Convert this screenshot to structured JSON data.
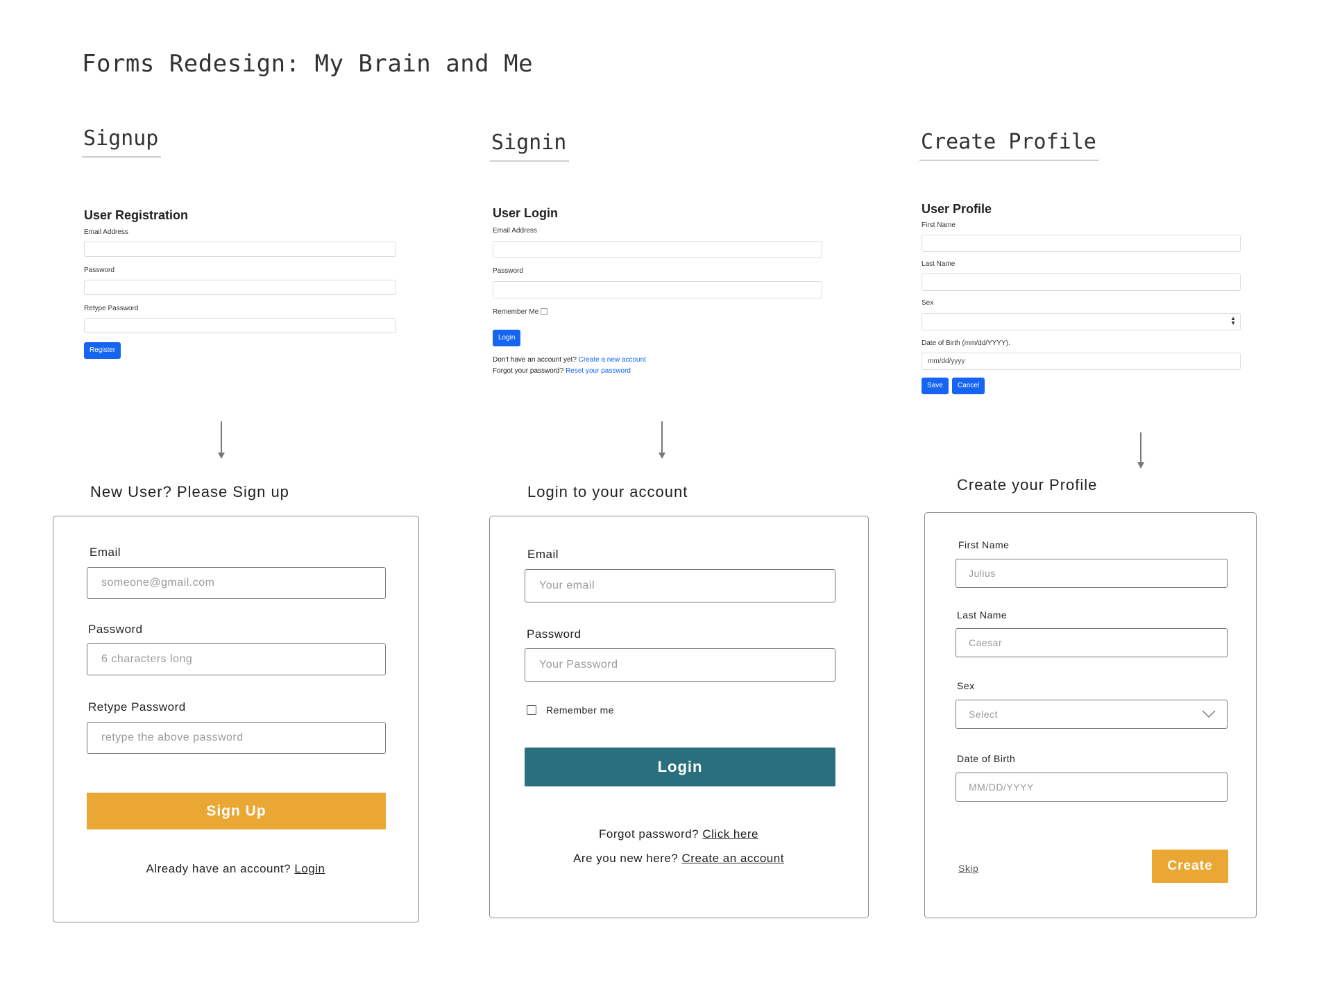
{
  "page_title": "Forms Redesign: My Brain and Me",
  "columns": {
    "signup": "Signup",
    "signin": "Signin",
    "profile": "Create Profile"
  },
  "old_signup": {
    "title": "User Registration",
    "email_label": "Email Address",
    "password_label": "Password",
    "retype_label": "Retype Password",
    "register_button": "Register"
  },
  "old_login": {
    "title": "User Login",
    "email_label": "Email Address",
    "password_label": "Password",
    "remember_label": "Remember Me",
    "login_button": "Login",
    "no_account_text": "Don't have an account yet?",
    "create_link": "Create a new account",
    "forgot_text": "Forgot your password?",
    "reset_link": "Reset your password"
  },
  "old_profile": {
    "title": "User Profile",
    "first_name_label": "First Name",
    "last_name_label": "Last Name",
    "sex_label": "Sex",
    "dob_label": "Date of Birth (mm/dd/YYYY).",
    "dob_placeholder": "mm/dd/yyyy",
    "save_button": "Save",
    "cancel_button": "Cancel"
  },
  "new_signup": {
    "heading": "New User? Please Sign up",
    "email_label": "Email",
    "email_placeholder": "someone@gmail.com",
    "password_label": "Password",
    "password_placeholder": "6 characters long",
    "retype_label": "Retype Password",
    "retype_placeholder": "retype the above password",
    "signup_button": "Sign Up",
    "have_account_text": "Already have an account?",
    "login_link": "Login"
  },
  "new_login": {
    "heading": "Login to your account",
    "email_label": "Email",
    "email_placeholder": "Your email",
    "password_label": "Password",
    "password_placeholder": "Your Password",
    "remember_label": "Remember me",
    "login_button": "Login",
    "forgot_text": "Forgot password?",
    "click_here_link": "Click here",
    "new_here_text": "Are you new here?",
    "create_account_link": "Create an account"
  },
  "new_profile": {
    "heading": "Create your Profile",
    "first_name_label": "First Name",
    "first_name_placeholder": "Julius",
    "last_name_label": "Last Name",
    "last_name_placeholder": "Caesar",
    "sex_label": "Sex",
    "sex_placeholder": "Select",
    "dob_label": "Date of Birth",
    "dob_placeholder": "MM/DD/YYYY",
    "skip_link": "Skip",
    "create_button": "Create"
  },
  "colors": {
    "accent_orange": "#eba733",
    "accent_teal": "#2a6f7d",
    "bootstrap_blue": "#1565f2"
  }
}
